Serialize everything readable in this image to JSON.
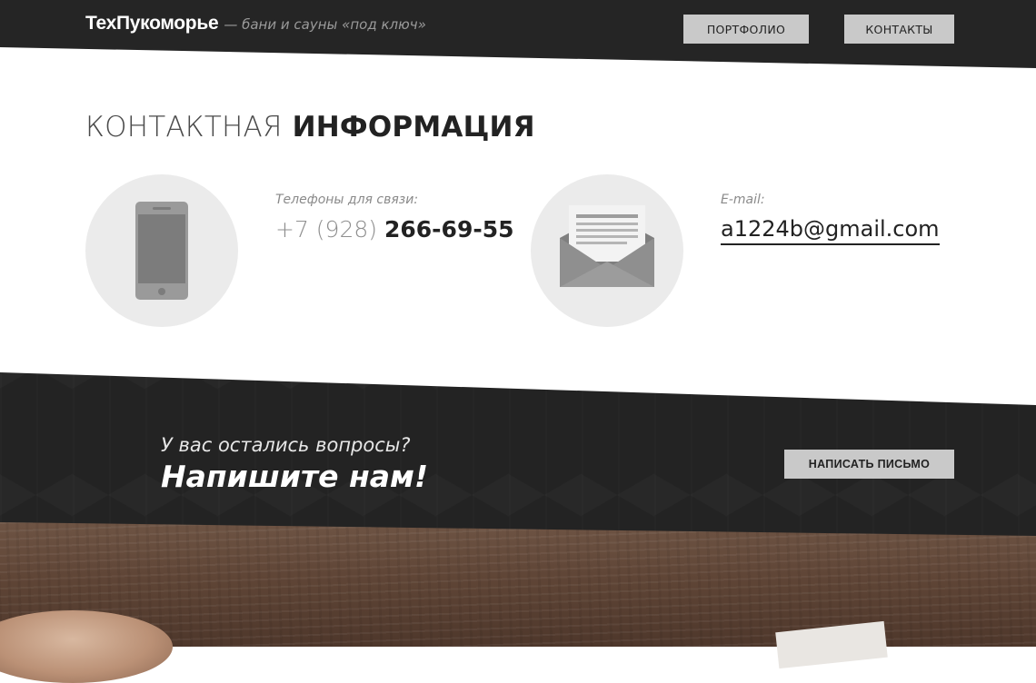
{
  "header": {
    "brand_name": "ТехПукоморье",
    "brand_tagline": "— бани и сауны «под ключ»",
    "nav": [
      {
        "label": "ПОРТФОЛИО"
      },
      {
        "label": "КОНТАКТЫ"
      }
    ]
  },
  "contacts": {
    "title_light": "КОНТАКТНАЯ",
    "title_bold": "ИНФОРМАЦИЯ",
    "phone": {
      "icon": "smartphone-icon",
      "label": "Телефоны для связи:",
      "prefix": "+7 (928)",
      "number": "266-69-55"
    },
    "email": {
      "icon": "envelope-icon",
      "label": "E-mail:",
      "value": "a1224b@gmail.com"
    }
  },
  "cta": {
    "question": "У вас остались вопросы?",
    "headline": "Напишите нам!",
    "button_label": "НАПИСАТЬ ПИСЬМО"
  },
  "colors": {
    "dark_band": "#252525",
    "button_bg": "#c9c9c9",
    "icon_circle": "#ebebeb",
    "icon_gray": "#8f8f8f"
  }
}
